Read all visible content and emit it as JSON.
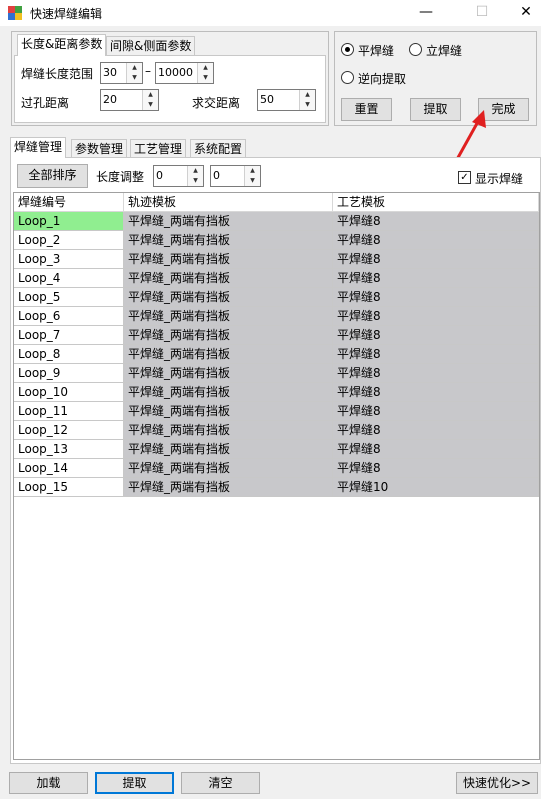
{
  "window": {
    "title": "快速焊缝编辑",
    "minimize": "—",
    "maximize": "☐",
    "close": "✕"
  },
  "param_tabs": [
    "长度&距离参数",
    "间隙&侧面参数"
  ],
  "params": {
    "length_range_label": "焊缝长度范围",
    "length_min": "30",
    "dash": "–",
    "length_max": "10000",
    "hole_label": "过孔距离",
    "hole_value": "20",
    "intersect_label": "求交距离",
    "intersect_value": "50"
  },
  "options": {
    "flat_weld": "平焊缝",
    "vertical_weld": "立焊缝",
    "reverse_extract": "逆向提取",
    "reset": "重置",
    "extract": "提取",
    "finish": "完成"
  },
  "main_tabs": [
    "焊缝管理",
    "参数管理",
    "工艺管理",
    "系统配置"
  ],
  "toolbar": {
    "sort_all": "全部排序",
    "length_adjust": "长度调整",
    "adj1": "0",
    "adj2": "0",
    "show_weld": "显示焊缝"
  },
  "grid": {
    "headers": [
      "焊缝编号",
      "轨迹模板",
      "工艺模板"
    ],
    "rows": [
      [
        "Loop_1",
        "平焊缝_两端有挡板",
        "平焊缝8"
      ],
      [
        "Loop_2",
        "平焊缝_两端有挡板",
        "平焊缝8"
      ],
      [
        "Loop_3",
        "平焊缝_两端有挡板",
        "平焊缝8"
      ],
      [
        "Loop_4",
        "平焊缝_两端有挡板",
        "平焊缝8"
      ],
      [
        "Loop_5",
        "平焊缝_两端有挡板",
        "平焊缝8"
      ],
      [
        "Loop_6",
        "平焊缝_两端有挡板",
        "平焊缝8"
      ],
      [
        "Loop_7",
        "平焊缝_两端有挡板",
        "平焊缝8"
      ],
      [
        "Loop_8",
        "平焊缝_两端有挡板",
        "平焊缝8"
      ],
      [
        "Loop_9",
        "平焊缝_两端有挡板",
        "平焊缝8"
      ],
      [
        "Loop_10",
        "平焊缝_两端有挡板",
        "平焊缝8"
      ],
      [
        "Loop_11",
        "平焊缝_两端有挡板",
        "平焊缝8"
      ],
      [
        "Loop_12",
        "平焊缝_两端有挡板",
        "平焊缝8"
      ],
      [
        "Loop_13",
        "平焊缝_两端有挡板",
        "平焊缝8"
      ],
      [
        "Loop_14",
        "平焊缝_两端有挡板",
        "平焊缝8"
      ],
      [
        "Loop_15",
        "平焊缝_两端有挡板",
        "平焊缝10"
      ]
    ]
  },
  "bottom": {
    "load": "加载",
    "extract": "提取",
    "clear": "清空",
    "quick_optimize": "快速优化>>"
  },
  "colors": {
    "selected_row": "#90ee90",
    "readonly_cell": "#c8c8cb",
    "annotation_arrow": "#e02020",
    "focus": "#0078d7"
  },
  "icons": {
    "app": "app-icon",
    "arrow": "red-arrow-annotation"
  }
}
